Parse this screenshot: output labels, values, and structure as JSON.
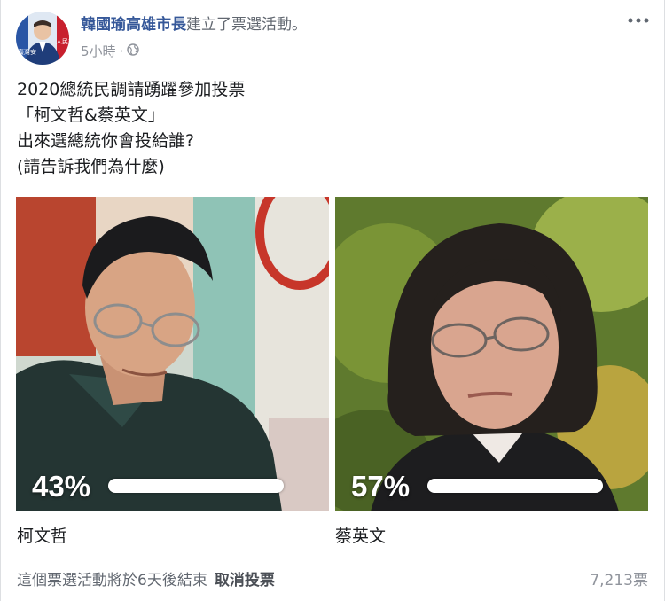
{
  "post": {
    "author": "韓國瑜高雄市長",
    "action": "建立了票選活動。",
    "time": "5小時",
    "separator": " · ",
    "privacy_icon": "globe-icon",
    "more_icon": "more-options-icon",
    "avatar_badges": [
      "臺灣安",
      "人民有"
    ],
    "lines": [
      "2020總統民調請踴躍參加投票",
      "「柯文哲&蔡英文」",
      "出來選總統你會投給誰?",
      "(請告訴我們為什麼)"
    ]
  },
  "poll": {
    "options": [
      {
        "name": "柯文哲",
        "percent_label": "43%",
        "percent": 43
      },
      {
        "name": "蔡英文",
        "percent_label": "57%",
        "percent": 57
      }
    ],
    "footer_text": "這個票選活動將於6天後結束",
    "cancel_label": "取消投票",
    "vote_count": "7,213票"
  },
  "colors": {
    "author_link": "#365899",
    "secondary_text": "#616770",
    "meta_text": "#90949c",
    "bar_fill": "#ffffff"
  }
}
